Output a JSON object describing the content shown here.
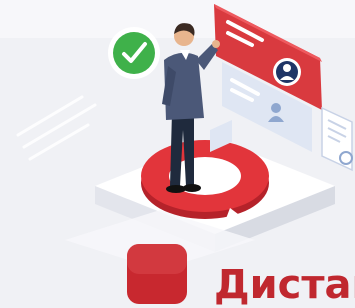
{
  "caption": {
    "text": "Дистан"
  },
  "colors": {
    "accent": "#c8282f",
    "check_green": "#3fb14a",
    "background": "#f0f1f5",
    "panel_red": "#d93a3f",
    "panel_light": "#dfe6f3"
  },
  "icons": [
    "check-icon",
    "profile-card-icon",
    "user-icon",
    "document-icon"
  ]
}
